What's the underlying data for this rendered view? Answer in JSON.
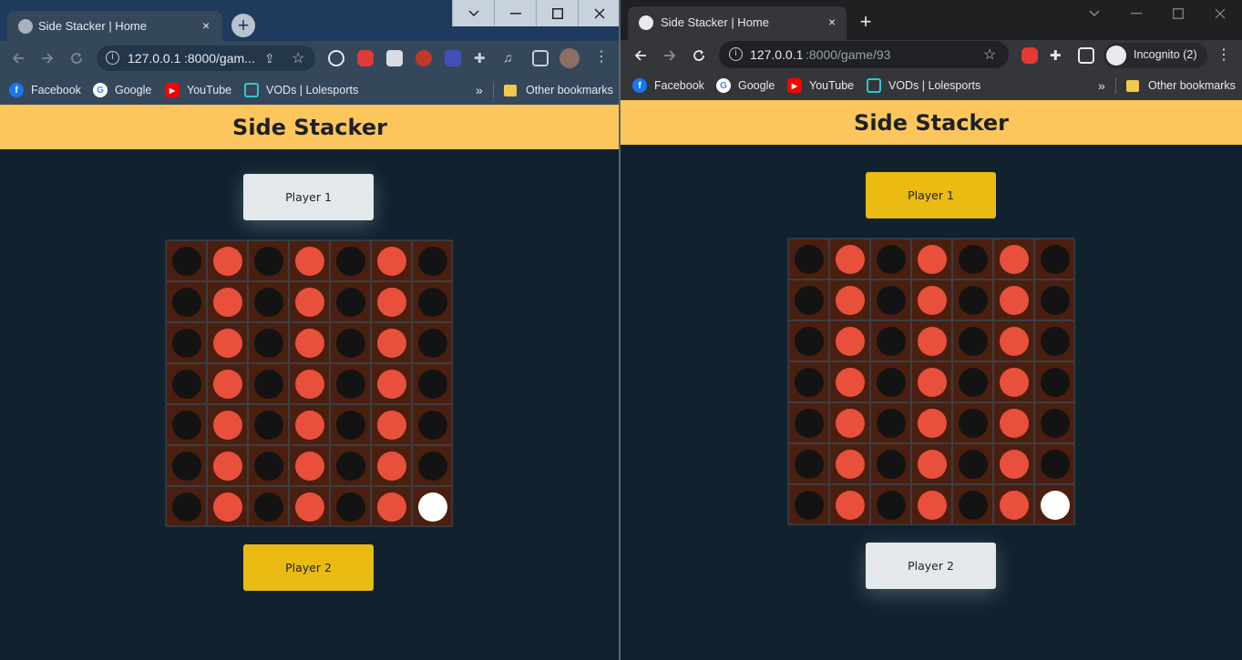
{
  "windows": [
    {
      "tab_title": "Side Stacker | Home",
      "tab_close": "×",
      "new_tab": "+",
      "url_host": "127.0.0.1",
      "url_rest": ":8000/gam...",
      "bookmarks": [
        "Facebook",
        "Google",
        "YouTube",
        "VODs | Lolesports"
      ],
      "bookmarks_overflow": "»",
      "other_bookmarks": "Other bookmarks",
      "page": {
        "title": "Side Stacker",
        "player1_label": "Player 1",
        "player2_label": "Player 2",
        "active_player": "player2"
      }
    },
    {
      "tab_title": "Side Stacker | Home",
      "tab_close": "×",
      "new_tab": "+",
      "url_host": "127.0.0.1",
      "url_rest": ":8000/game/93",
      "incognito_label": "Incognito (2)",
      "bookmarks": [
        "Facebook",
        "Google",
        "YouTube",
        "VODs | Lolesports"
      ],
      "bookmarks_overflow": "»",
      "other_bookmarks": "Other bookmarks",
      "page": {
        "title": "Side Stacker",
        "player1_label": "Player 1",
        "player2_label": "Player 2",
        "active_player": "player1"
      }
    }
  ],
  "board": {
    "rows": 7,
    "cols": 7,
    "cells": [
      [
        "B",
        "R",
        "B",
        "R",
        "B",
        "R",
        "B"
      ],
      [
        "B",
        "R",
        "B",
        "R",
        "B",
        "R",
        "B"
      ],
      [
        "B",
        "R",
        "B",
        "R",
        "B",
        "R",
        "B"
      ],
      [
        "B",
        "R",
        "B",
        "R",
        "B",
        "R",
        "B"
      ],
      [
        "B",
        "R",
        "B",
        "R",
        "B",
        "R",
        "B"
      ],
      [
        "B",
        "R",
        "B",
        "R",
        "B",
        "R",
        "B"
      ],
      [
        "B",
        "R",
        "B",
        "R",
        "B",
        "R",
        "E"
      ]
    ],
    "legend": {
      "B": "black-disc",
      "R": "red-disc",
      "E": "empty-slot"
    }
  },
  "colors": {
    "header_bg": "#fdc65c",
    "page_bg": "#11222e",
    "board_bg": "#4a1f10",
    "disc_black": "#131313",
    "disc_red": "#e8503c",
    "slot_empty": "#ffffff",
    "player_active": "#e9bb13",
    "player_idle": "#e5e8eb"
  },
  "icons": {
    "back": "arrow-left-icon",
    "forward": "arrow-right-icon",
    "reload": "reload-icon",
    "site_info": "info-icon",
    "share": "share-icon",
    "star": "star-icon",
    "extensions": "puzzle-icon",
    "menu": "kebab-menu-icon",
    "incognito": "incognito-icon",
    "minimize": "minimize-icon",
    "maximize": "maximize-icon",
    "close": "close-icon",
    "chevron": "chevron-down-icon"
  }
}
